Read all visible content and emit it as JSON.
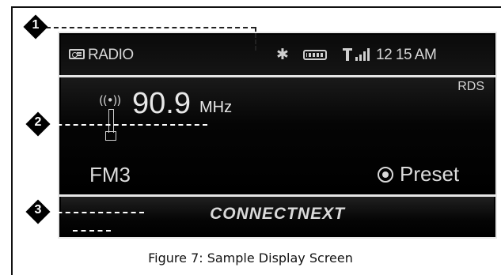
{
  "status_bar": {
    "source_icon": "radio-icon",
    "title": "RADIO",
    "bluetooth_icon": "bluetooth-icon",
    "battery_icon": "battery-icon",
    "signal_icon": "signal-strength-icon",
    "time": "12 15 AM"
  },
  "tuner": {
    "antenna_icon": "antenna-icon",
    "frequency": "90.9",
    "unit": "MHz",
    "rds": "RDS",
    "band": "FM3",
    "preset_icon": "preset-knob-icon",
    "preset_label": "Preset"
  },
  "brand": {
    "logo_text": "CONNECTNEXT"
  },
  "callouts": [
    "1",
    "2",
    "3"
  ],
  "caption": "Figure 7: Sample Display Screen",
  "colors": {
    "screen_bg": "#000000",
    "screen_text": "#dcdcdc",
    "divider": "#e6e6e6",
    "callout_bg": "#000000"
  }
}
